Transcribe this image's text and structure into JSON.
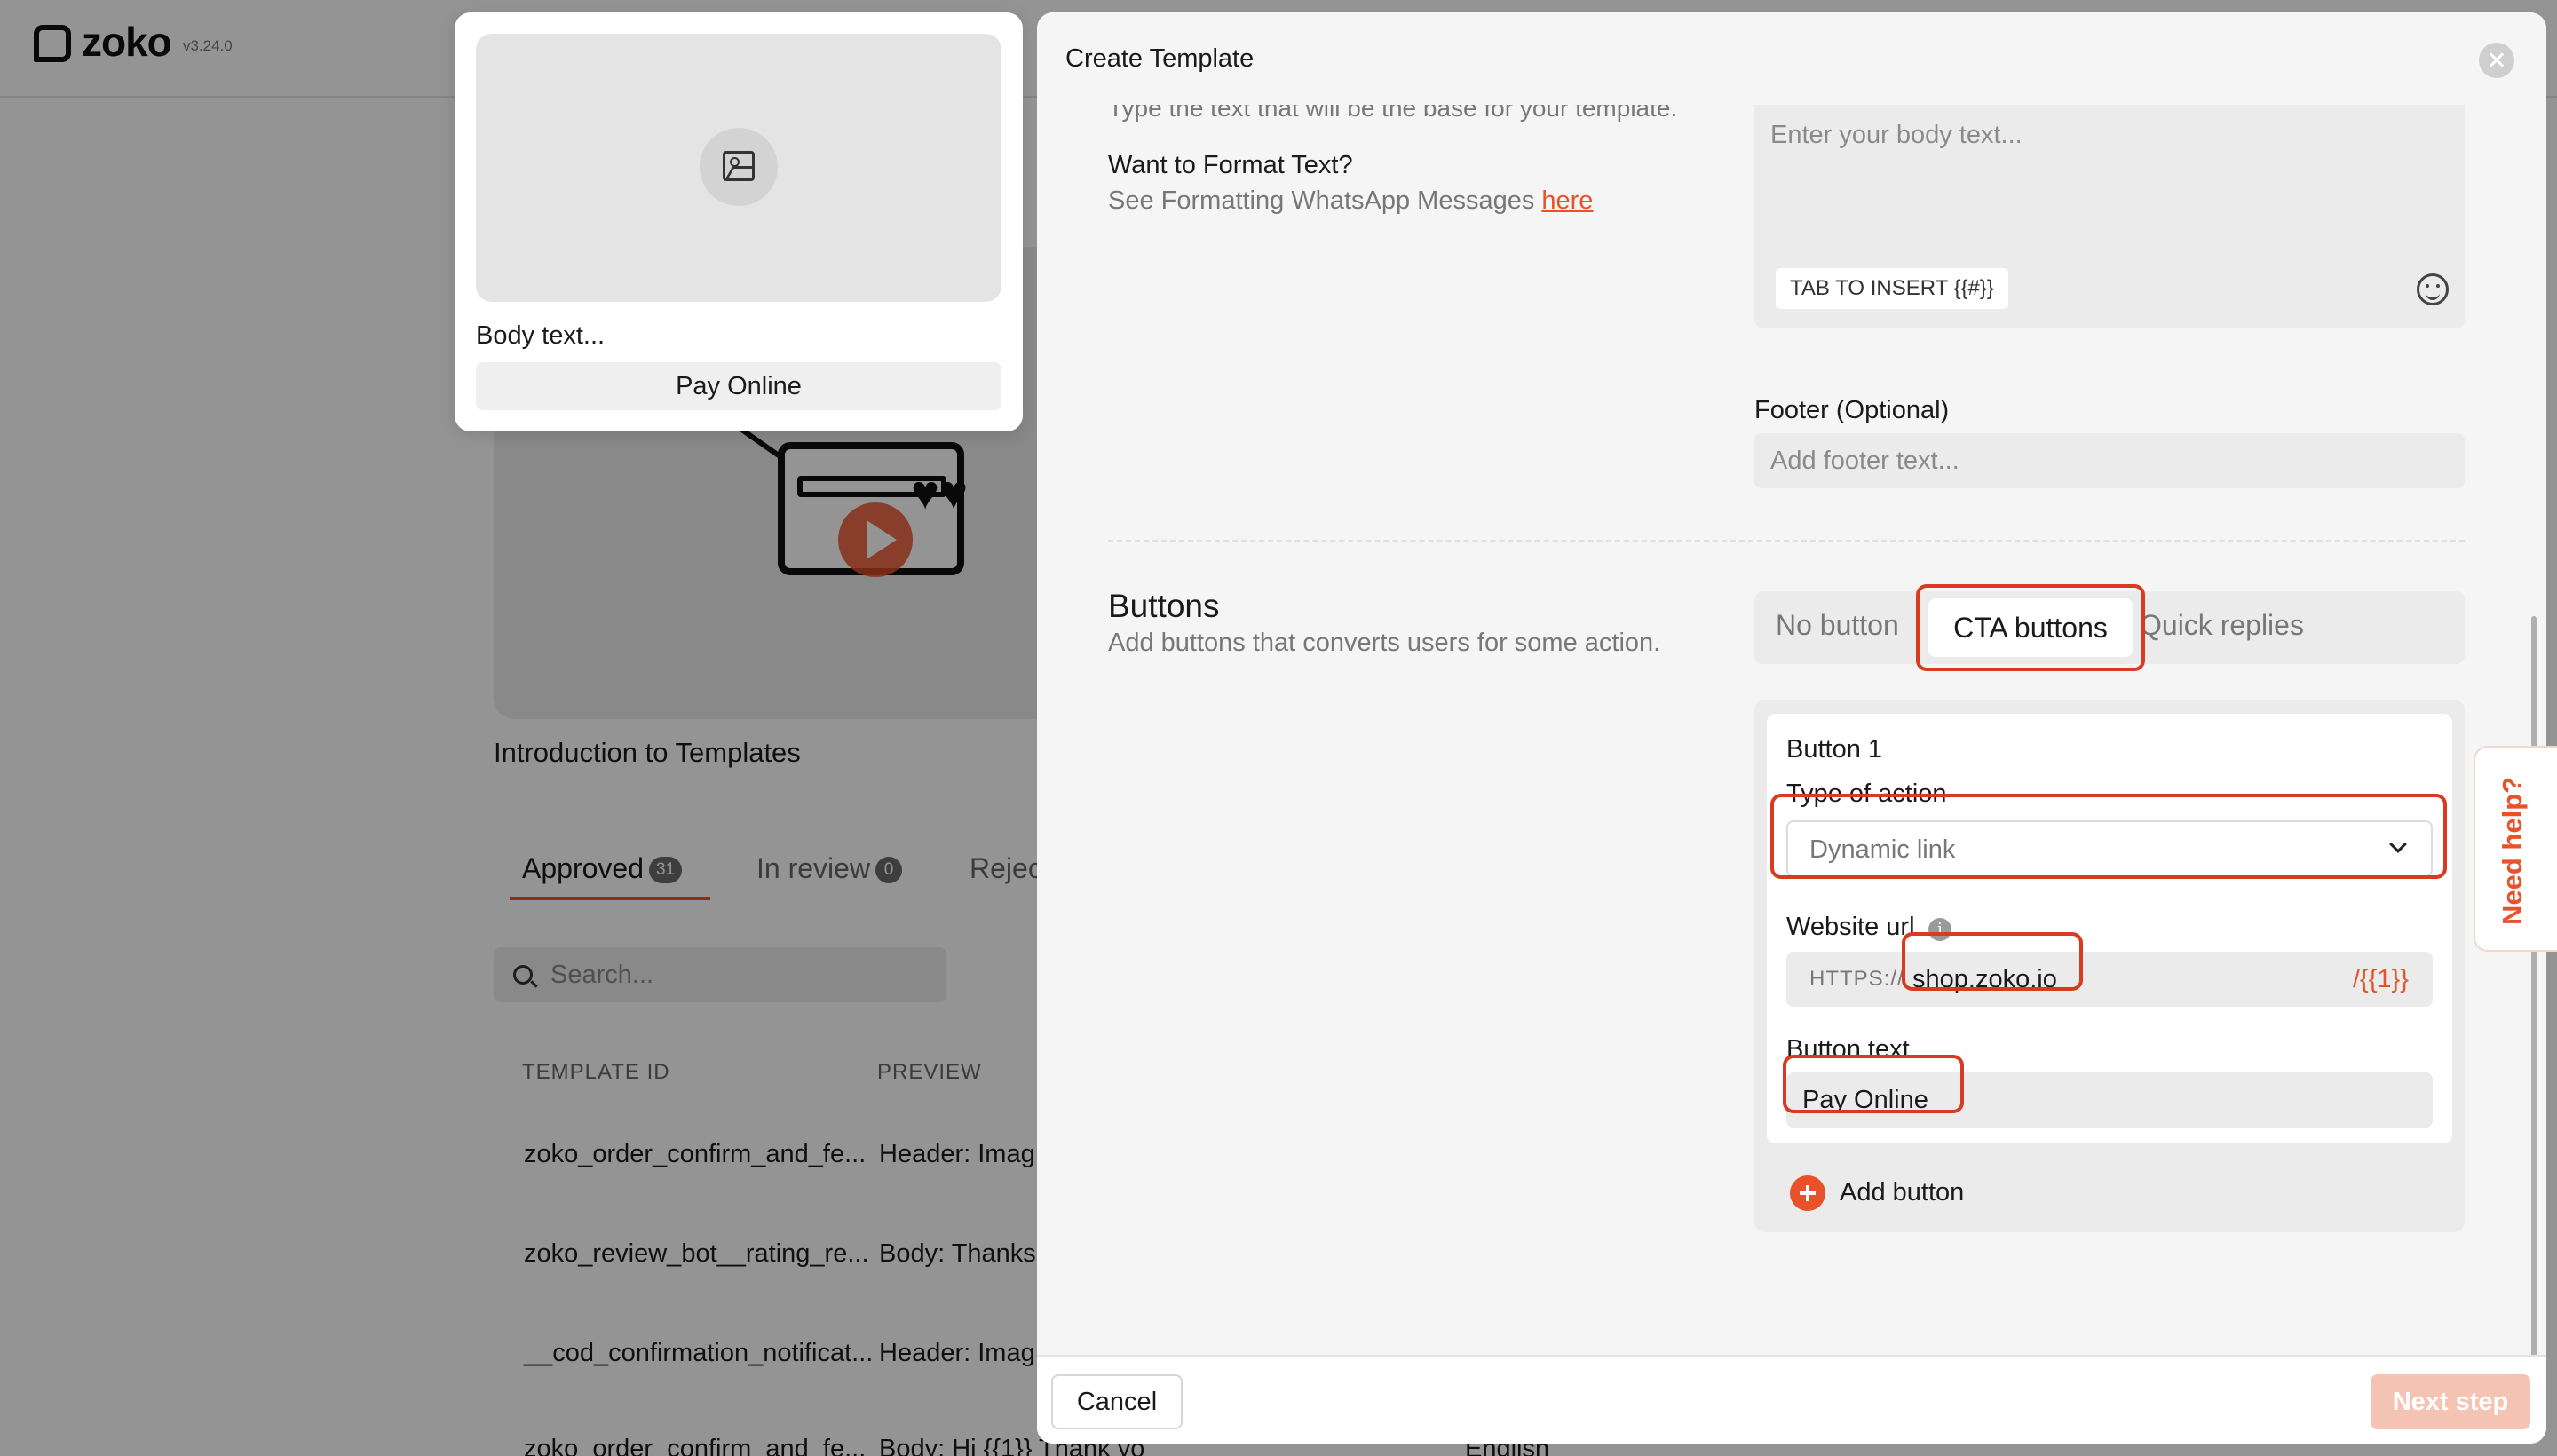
{
  "app": {
    "logo_text": "zoko",
    "version": "v3.24.0"
  },
  "background": {
    "video_title": "Introduction to Templates",
    "tabs": [
      {
        "label": "Approved",
        "count": "31"
      },
      {
        "label": "In review",
        "count": "0"
      },
      {
        "label": "Rejec"
      }
    ],
    "search_placeholder": "Search...",
    "columns": [
      "TEMPLATE ID",
      "PREVIEW"
    ],
    "rows": [
      {
        "id": "zoko_order_confirm_and_fe...",
        "preview": "Header: Imag"
      },
      {
        "id": "zoko_review_bot__rating_re...",
        "preview": "Body: Thanks"
      },
      {
        "id": "__cod_confirmation_notificat...",
        "preview": "Header: Imag"
      },
      {
        "id": "zoko_order_confirm_and_fe...",
        "preview": "Body: Hi {{1}} Thank yo",
        "language": "English"
      }
    ]
  },
  "preview": {
    "body_text": "Body text...",
    "button_label": "Pay Online"
  },
  "modal": {
    "title": "Create Template",
    "body_section": {
      "description": "Type the text that will be the base for your template.",
      "format_title": "Want to Format Text?",
      "format_desc": "See Formatting WhatsApp Messages ",
      "format_link": "here",
      "body_placeholder": "Enter your body text...",
      "tab_insert": "TAB TO INSERT {{#}}"
    },
    "footer_section": {
      "label": "Footer (Optional)",
      "placeholder": "Add footer text..."
    },
    "buttons_section": {
      "title": "Buttons",
      "description": "Add buttons that converts users for some action.",
      "options": [
        "No button",
        "CTA buttons",
        "Quick replies"
      ],
      "selected": "CTA buttons",
      "button1": {
        "label": "Button 1",
        "action_label": "Type of action",
        "action_value": "Dynamic link",
        "url_label": "Website url",
        "url_prefix": "HTTPS://",
        "url_value": "shop.zoko.io",
        "url_variable": "/{{1}}",
        "text_label": "Button text",
        "text_value": "Pay Online"
      },
      "add_button_label": "Add button"
    },
    "footer": {
      "cancel": "Cancel",
      "next": "Next step"
    }
  },
  "help_tab": "Need help?",
  "colors": {
    "accent": "#e8512a",
    "highlight": "#d83a22"
  }
}
